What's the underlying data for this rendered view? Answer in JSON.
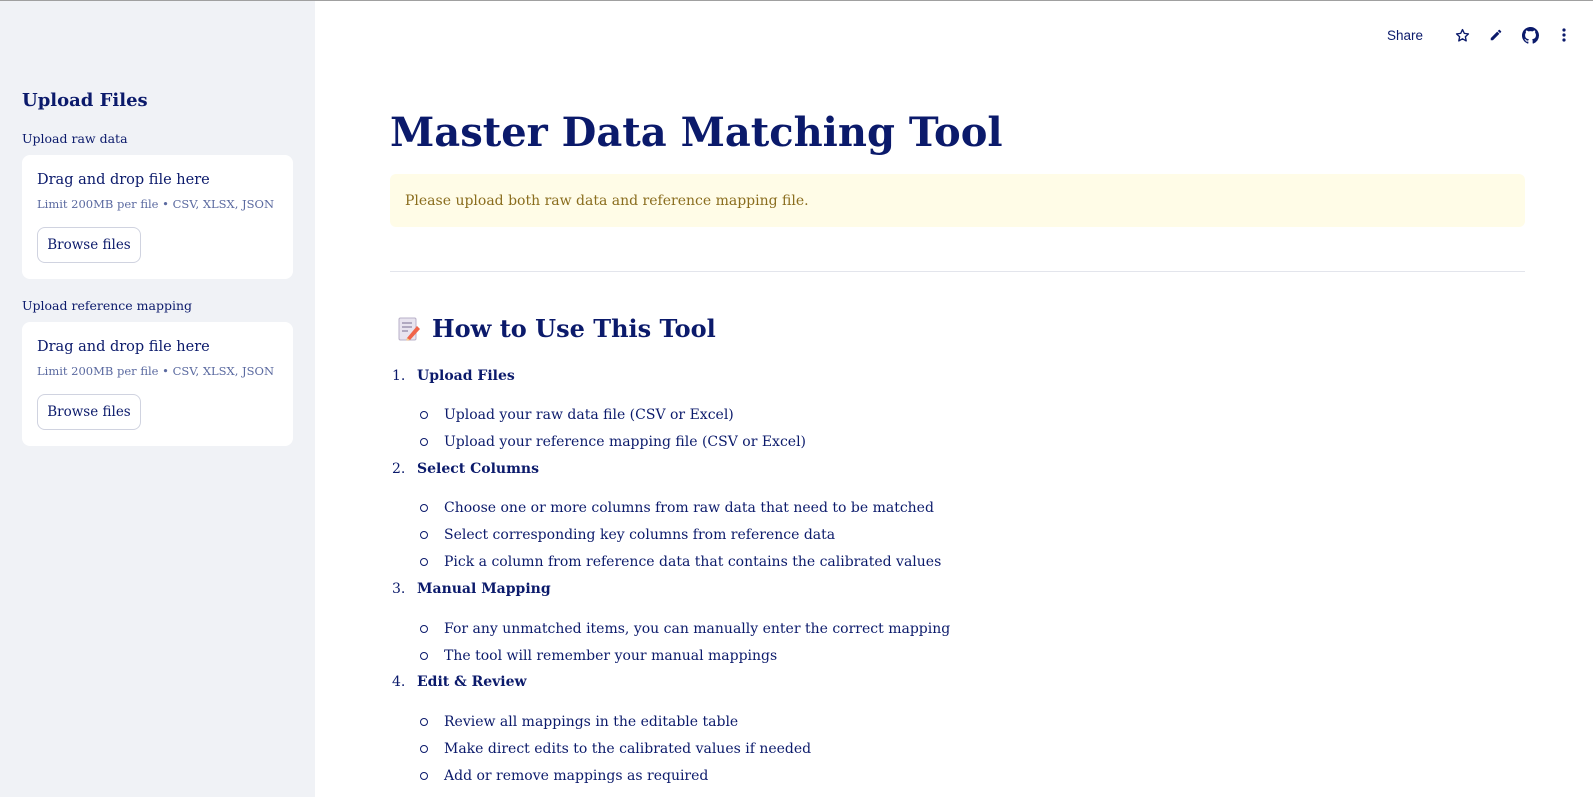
{
  "sidebar": {
    "heading": "Upload Files",
    "uploaders": [
      {
        "label": "Upload raw data",
        "title": "Drag and drop file here",
        "limit": "Limit 200MB per file • CSV, XLSX, JSON",
        "button": "Browse files"
      },
      {
        "label": "Upload reference mapping",
        "title": "Drag and drop file here",
        "limit": "Limit 200MB per file • CSV, XLSX, JSON",
        "button": "Browse files"
      }
    ]
  },
  "topbar": {
    "share": "Share",
    "icons": [
      "star-icon",
      "pencil-icon",
      "github-icon",
      "more-vertical-icon"
    ]
  },
  "main": {
    "title": "Master Data Matching Tool",
    "alert": "Please upload both raw data and reference mapping file.",
    "howto": {
      "icon": "memo-icon",
      "heading": "How to Use This Tool",
      "steps": [
        {
          "number": "1.",
          "title": "Upload Files",
          "items": [
            "Upload your raw data file (CSV or Excel)",
            "Upload your reference mapping file (CSV or Excel)"
          ]
        },
        {
          "number": "2.",
          "title": "Select Columns",
          "items": [
            "Choose one or more columns from raw data that need to be matched",
            "Select corresponding key columns from reference data",
            "Pick a column from reference data that contains the calibrated values"
          ]
        },
        {
          "number": "3.",
          "title": "Manual Mapping",
          "items": [
            "For any unmatched items, you can manually enter the correct mapping",
            "The tool will remember your manual mappings"
          ]
        },
        {
          "number": "4.",
          "title": "Edit & Review",
          "items": [
            "Review all mappings in the editable table",
            "Make direct edits to the calibrated values if needed",
            "Add or remove mappings as required"
          ]
        }
      ]
    }
  },
  "colors": {
    "text": "#0b1a6b",
    "sidebar_bg": "#f0f2f6",
    "alert_bg": "#fffce7",
    "alert_text": "#8a6d1e"
  }
}
